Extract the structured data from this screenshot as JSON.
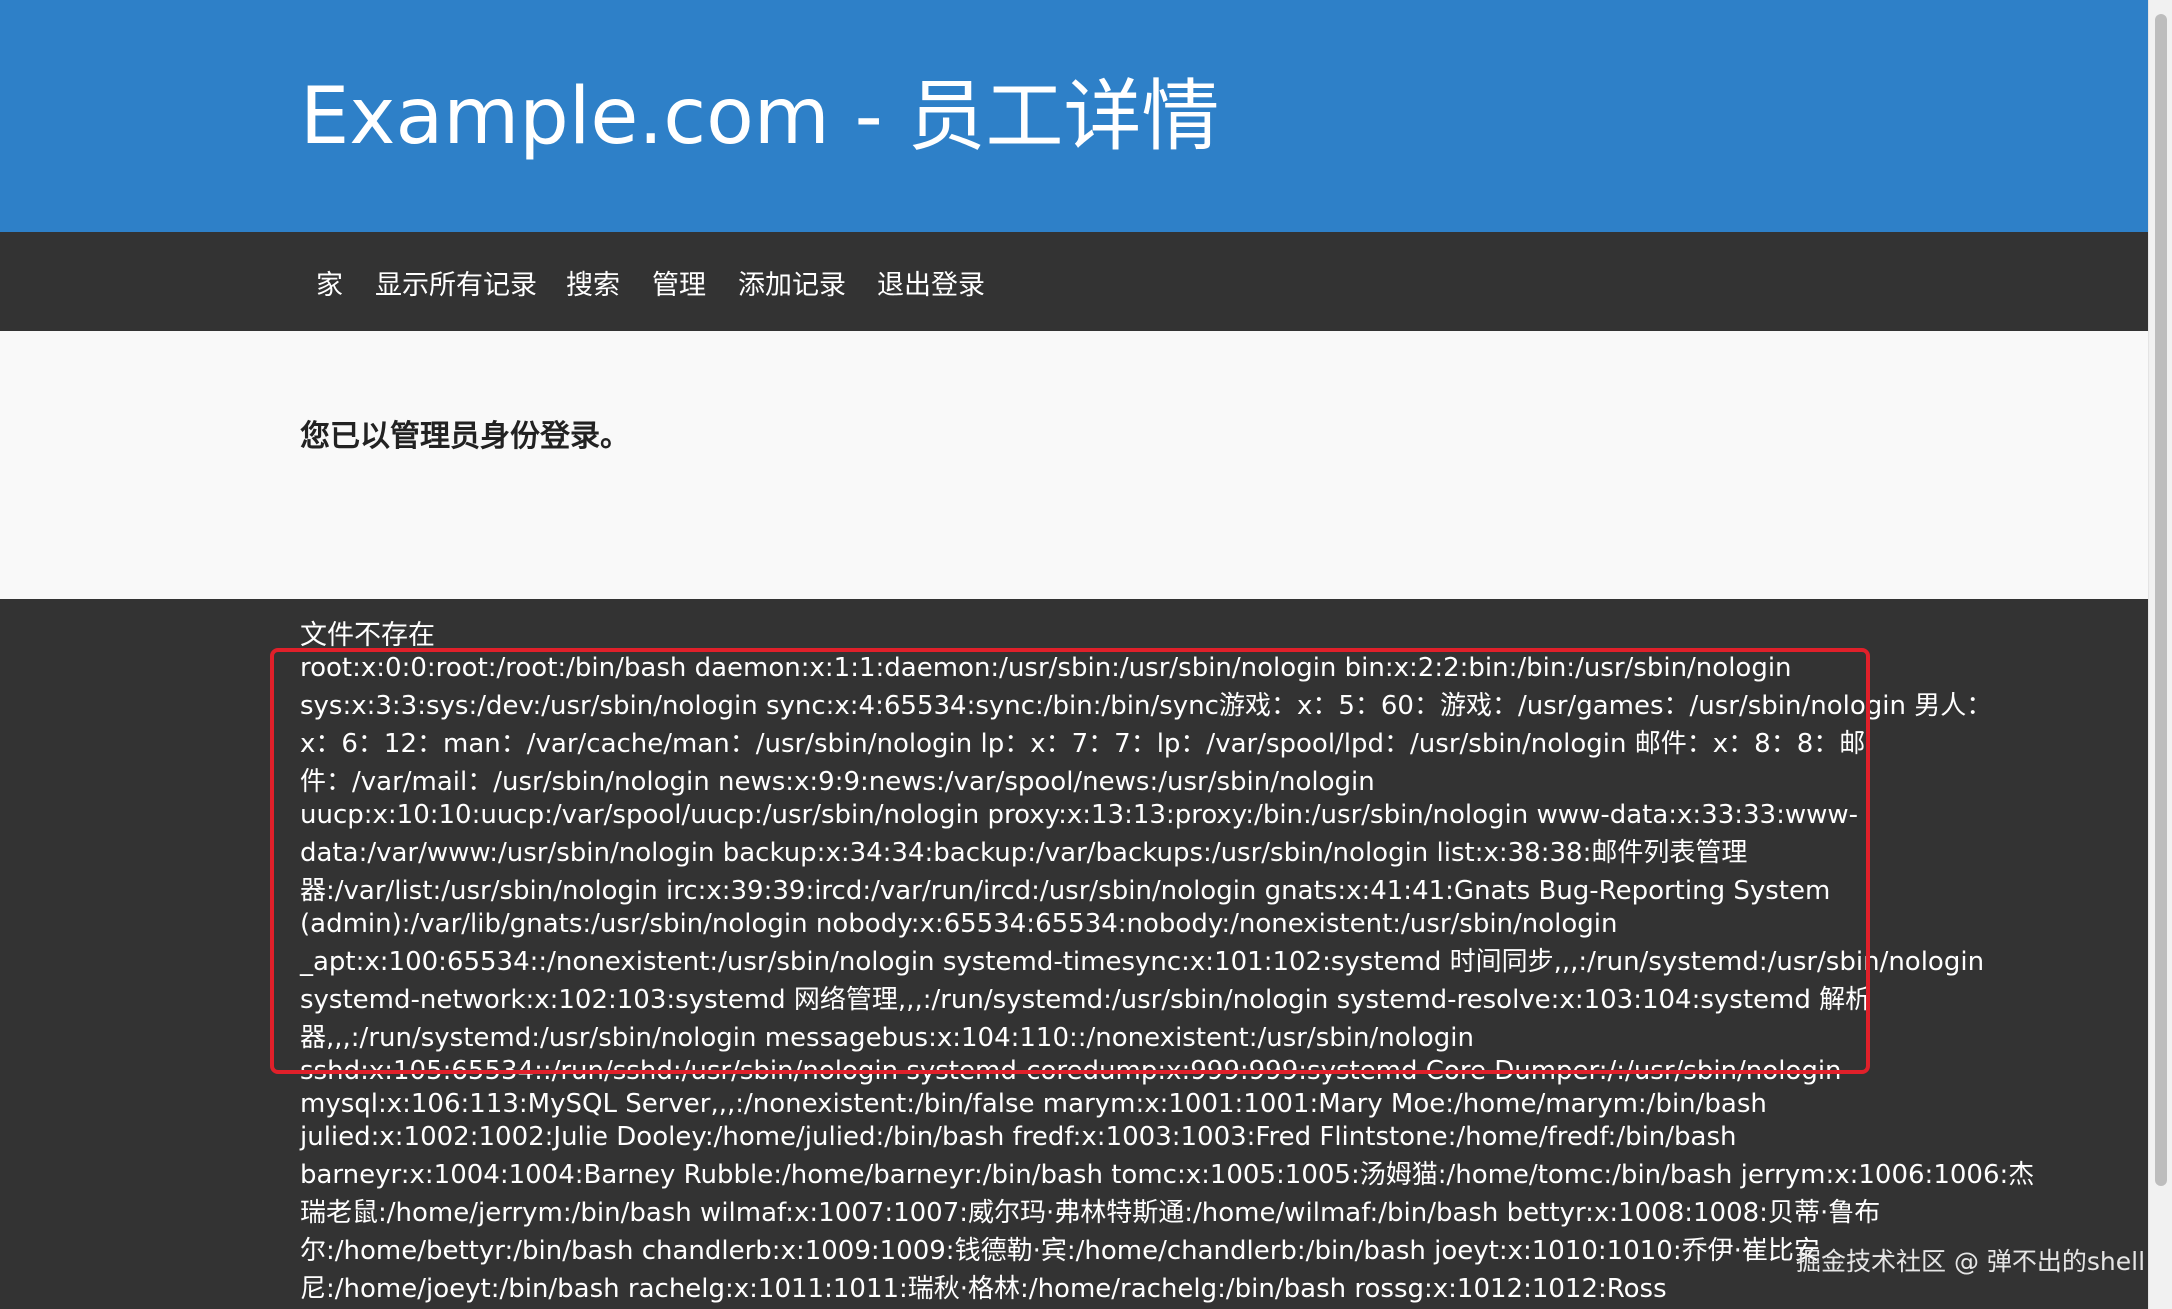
{
  "header": {
    "title": "Example.com - 员工详情"
  },
  "nav": {
    "items": [
      {
        "label": "家"
      },
      {
        "label": "显示所有记录"
      },
      {
        "label": "搜索"
      },
      {
        "label": "管理"
      },
      {
        "label": "添加记录"
      },
      {
        "label": "退出登录"
      }
    ]
  },
  "main": {
    "login_message": "您已以管理员身份登录。"
  },
  "footer": {
    "file_message": "文件不存在",
    "passwd_lines": [
      "root:x:0:0:root:/root:/bin/bash daemon:x:1:1:daemon:/usr/sbin:/usr/sbin/nologin bin:x:2:2:bin:/bin:/usr/sbin/nologin",
      "sys:x:3:3:sys:/dev:/usr/sbin/nologin sync:x:4:65534:sync:/bin:/bin/sync游戏：x：5：60：游戏：/usr/games：/usr/sbin/nologin 男人：",
      "x：6：12：man：/var/cache/man：/usr/sbin/nologin lp：x：7：7：lp：/var/spool/lpd：/usr/sbin/nologin 邮件：x：8：8：邮",
      "件：/var/mail：/usr/sbin/nologin news:x:9:9:news:/var/spool/news:/usr/sbin/nologin",
      "uucp:x:10:10:uucp:/var/spool/uucp:/usr/sbin/nologin proxy:x:13:13:proxy:/bin:/usr/sbin/nologin www-data:x:33:33:www-",
      "data:/var/www:/usr/sbin/nologin backup:x:34:34:backup:/var/backups:/usr/sbin/nologin list:x:38:38:邮件列表管理",
      "器:/var/list:/usr/sbin/nologin irc:x:39:39:ircd:/var/run/ircd:/usr/sbin/nologin gnats:x:41:41:Gnats Bug-Reporting System",
      "(admin):/var/lib/gnats:/usr/sbin/nologin nobody:x:65534:65534:nobody:/nonexistent:/usr/sbin/nologin",
      "_apt:x:100:65534::/nonexistent:/usr/sbin/nologin systemd-timesync:x:101:102:systemd 时间同步,,,:/run/systemd:/usr/sbin/nologin",
      "systemd-network:x:102:103:systemd 网络管理,,,:/run/systemd:/usr/sbin/nologin systemd-resolve:x:103:104:systemd 解析",
      "器,,,:/run/systemd:/usr/sbin/nologin messagebus:x:104:110::/nonexistent:/usr/sbin/nologin",
      "sshd:x:105:65534::/run/sshd:/usr/sbin/nologin systemd-coredump:x:999:999:systemd Core Dumper:/:/usr/sbin/nologin",
      "mysql:x:106:113:MySQL Server,,,:/nonexistent:/bin/false marym:x:1001:1001:Mary Moe:/home/marym:/bin/bash",
      "julied:x:1002:1002:Julie Dooley:/home/julied:/bin/bash fredf:x:1003:1003:Fred Flintstone:/home/fredf:/bin/bash",
      "barneyr:x:1004:1004:Barney Rubble:/home/barneyr:/bin/bash tomc:x:1005:1005:汤姆猫:/home/tomc:/bin/bash jerrym:x:1006:1006:杰",
      "瑞老鼠:/home/jerrym:/bin/bash wilmaf:x:1007:1007:威尔玛·弗林特斯通:/home/wilmaf:/bin/bash bettyr:x:1008:1008:贝蒂·鲁布",
      "尔:/home/bettyr:/bin/bash chandlerb:x:1009:1009:钱德勒·宾:/home/chandlerb:/bin/bash joeyt:x:1010:1010:乔伊·崔比安",
      "尼:/home/joeyt:/bin/bash rachelg:x:1011:1011:瑞秋·格林:/home/rachelg:/bin/bash rossg:x:1012:1012:Ross"
    ]
  },
  "watermark": {
    "text": "掘金技术社区 @ 弹不出的shell"
  },
  "colors": {
    "header_bg": "#2e80c8",
    "nav_bg": "#333333",
    "content_bg": "#f9f9f9",
    "highlight": "#e0202a"
  }
}
